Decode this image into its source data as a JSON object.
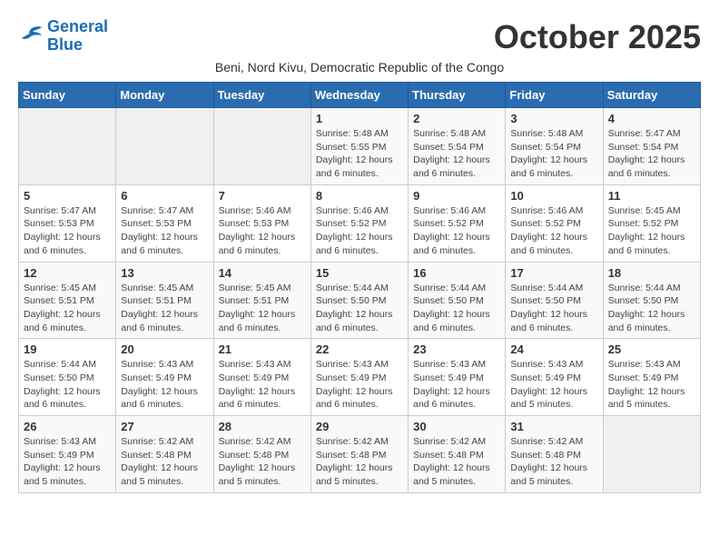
{
  "logo": {
    "line1": "General",
    "line2": "Blue"
  },
  "title": "October 2025",
  "subtitle": "Beni, Nord Kivu, Democratic Republic of the Congo",
  "days_of_week": [
    "Sunday",
    "Monday",
    "Tuesday",
    "Wednesday",
    "Thursday",
    "Friday",
    "Saturday"
  ],
  "weeks": [
    [
      {
        "day": "",
        "info": ""
      },
      {
        "day": "",
        "info": ""
      },
      {
        "day": "",
        "info": ""
      },
      {
        "day": "1",
        "info": "Sunrise: 5:48 AM\nSunset: 5:55 PM\nDaylight: 12 hours\nand 6 minutes."
      },
      {
        "day": "2",
        "info": "Sunrise: 5:48 AM\nSunset: 5:54 PM\nDaylight: 12 hours\nand 6 minutes."
      },
      {
        "day": "3",
        "info": "Sunrise: 5:48 AM\nSunset: 5:54 PM\nDaylight: 12 hours\nand 6 minutes."
      },
      {
        "day": "4",
        "info": "Sunrise: 5:47 AM\nSunset: 5:54 PM\nDaylight: 12 hours\nand 6 minutes."
      }
    ],
    [
      {
        "day": "5",
        "info": "Sunrise: 5:47 AM\nSunset: 5:53 PM\nDaylight: 12 hours\nand 6 minutes."
      },
      {
        "day": "6",
        "info": "Sunrise: 5:47 AM\nSunset: 5:53 PM\nDaylight: 12 hours\nand 6 minutes."
      },
      {
        "day": "7",
        "info": "Sunrise: 5:46 AM\nSunset: 5:53 PM\nDaylight: 12 hours\nand 6 minutes."
      },
      {
        "day": "8",
        "info": "Sunrise: 5:46 AM\nSunset: 5:52 PM\nDaylight: 12 hours\nand 6 minutes."
      },
      {
        "day": "9",
        "info": "Sunrise: 5:46 AM\nSunset: 5:52 PM\nDaylight: 12 hours\nand 6 minutes."
      },
      {
        "day": "10",
        "info": "Sunrise: 5:46 AM\nSunset: 5:52 PM\nDaylight: 12 hours\nand 6 minutes."
      },
      {
        "day": "11",
        "info": "Sunrise: 5:45 AM\nSunset: 5:52 PM\nDaylight: 12 hours\nand 6 minutes."
      }
    ],
    [
      {
        "day": "12",
        "info": "Sunrise: 5:45 AM\nSunset: 5:51 PM\nDaylight: 12 hours\nand 6 minutes."
      },
      {
        "day": "13",
        "info": "Sunrise: 5:45 AM\nSunset: 5:51 PM\nDaylight: 12 hours\nand 6 minutes."
      },
      {
        "day": "14",
        "info": "Sunrise: 5:45 AM\nSunset: 5:51 PM\nDaylight: 12 hours\nand 6 minutes."
      },
      {
        "day": "15",
        "info": "Sunrise: 5:44 AM\nSunset: 5:50 PM\nDaylight: 12 hours\nand 6 minutes."
      },
      {
        "day": "16",
        "info": "Sunrise: 5:44 AM\nSunset: 5:50 PM\nDaylight: 12 hours\nand 6 minutes."
      },
      {
        "day": "17",
        "info": "Sunrise: 5:44 AM\nSunset: 5:50 PM\nDaylight: 12 hours\nand 6 minutes."
      },
      {
        "day": "18",
        "info": "Sunrise: 5:44 AM\nSunset: 5:50 PM\nDaylight: 12 hours\nand 6 minutes."
      }
    ],
    [
      {
        "day": "19",
        "info": "Sunrise: 5:44 AM\nSunset: 5:50 PM\nDaylight: 12 hours\nand 6 minutes."
      },
      {
        "day": "20",
        "info": "Sunrise: 5:43 AM\nSunset: 5:49 PM\nDaylight: 12 hours\nand 6 minutes."
      },
      {
        "day": "21",
        "info": "Sunrise: 5:43 AM\nSunset: 5:49 PM\nDaylight: 12 hours\nand 6 minutes."
      },
      {
        "day": "22",
        "info": "Sunrise: 5:43 AM\nSunset: 5:49 PM\nDaylight: 12 hours\nand 6 minutes."
      },
      {
        "day": "23",
        "info": "Sunrise: 5:43 AM\nSunset: 5:49 PM\nDaylight: 12 hours\nand 6 minutes."
      },
      {
        "day": "24",
        "info": "Sunrise: 5:43 AM\nSunset: 5:49 PM\nDaylight: 12 hours\nand 5 minutes."
      },
      {
        "day": "25",
        "info": "Sunrise: 5:43 AM\nSunset: 5:49 PM\nDaylight: 12 hours\nand 5 minutes."
      }
    ],
    [
      {
        "day": "26",
        "info": "Sunrise: 5:43 AM\nSunset: 5:49 PM\nDaylight: 12 hours\nand 5 minutes."
      },
      {
        "day": "27",
        "info": "Sunrise: 5:42 AM\nSunset: 5:48 PM\nDaylight: 12 hours\nand 5 minutes."
      },
      {
        "day": "28",
        "info": "Sunrise: 5:42 AM\nSunset: 5:48 PM\nDaylight: 12 hours\nand 5 minutes."
      },
      {
        "day": "29",
        "info": "Sunrise: 5:42 AM\nSunset: 5:48 PM\nDaylight: 12 hours\nand 5 minutes."
      },
      {
        "day": "30",
        "info": "Sunrise: 5:42 AM\nSunset: 5:48 PM\nDaylight: 12 hours\nand 5 minutes."
      },
      {
        "day": "31",
        "info": "Sunrise: 5:42 AM\nSunset: 5:48 PM\nDaylight: 12 hours\nand 5 minutes."
      },
      {
        "day": "",
        "info": ""
      }
    ]
  ]
}
